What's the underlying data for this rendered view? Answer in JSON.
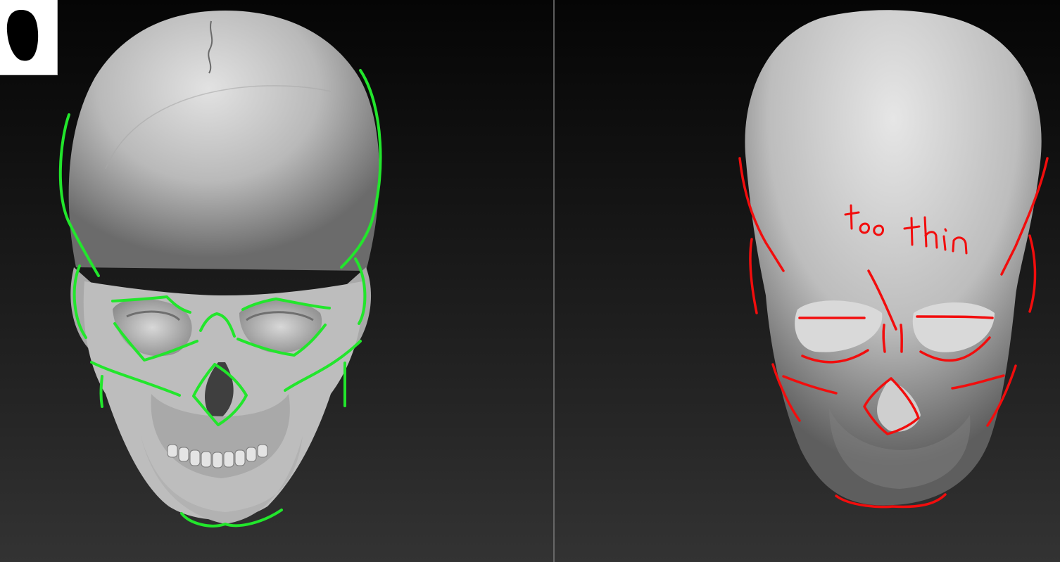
{
  "icons": {
    "thumbnail": "head-silhouette-icon"
  },
  "colors": {
    "reference_outline": "#22e62c",
    "sculpt_outline": "#f20d0d",
    "bone": "#cfcfcf",
    "background_top": "#050505",
    "background_bottom": "#333333"
  },
  "annotation": {
    "text": "too thin"
  }
}
